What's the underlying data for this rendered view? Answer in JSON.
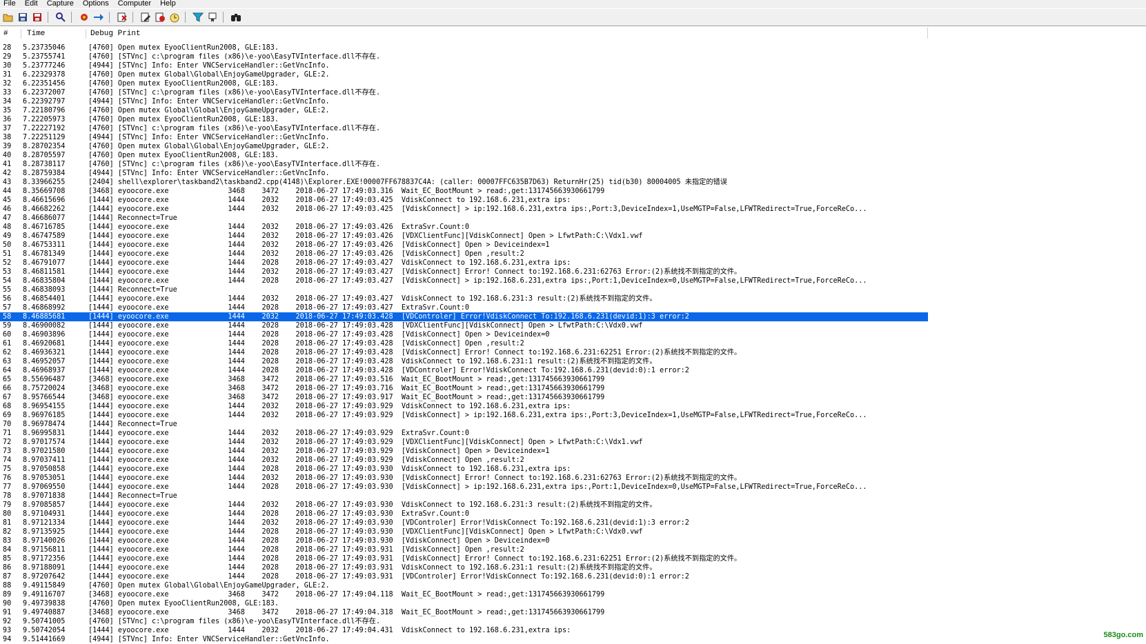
{
  "menu": [
    "File",
    "Edit",
    "Capture",
    "Options",
    "Computer",
    "Help"
  ],
  "toolbar_icons": [
    "open-icon",
    "save-icon",
    "save-as-icon",
    "find-icon",
    "capture-icon",
    "autoscroll-icon",
    "clear-icon",
    "edit-filter-icon",
    "highlight-icon",
    "history-icon",
    "filter-icon",
    "bookmark-icon",
    "binoculars-icon"
  ],
  "columns": [
    "#",
    "Time",
    "Debug Print"
  ],
  "selected_row": 58,
  "selection_color": "#0a67e8",
  "rows": [
    {
      "n": "28",
      "t": "5.23735046",
      "text": "[4760] Open mutex EyooClientRun2008, GLE:183."
    },
    {
      "n": "29",
      "t": "5.23755741",
      "text": "[4760] [STVnc] c:\\program files (x86)\\e-yoo\\EasyTVInterface.dll不存在."
    },
    {
      "n": "30",
      "t": "5.23777246",
      "text": "[4944] [STVnc] Info: Enter VNCServiceHandler::GetVncInfo."
    },
    {
      "n": "31",
      "t": "6.22329378",
      "text": "[4760] Open mutex Global\\Global\\EnjoyGameUpgrader, GLE:2."
    },
    {
      "n": "32",
      "t": "6.22351456",
      "text": "[4760] Open mutex EyooClientRun2008, GLE:183."
    },
    {
      "n": "33",
      "t": "6.22372007",
      "text": "[4760] [STVnc] c:\\program files (x86)\\e-yoo\\EasyTVInterface.dll不存在."
    },
    {
      "n": "34",
      "t": "6.22392797",
      "text": "[4944] [STVnc] Info: Enter VNCServiceHandler::GetVncInfo."
    },
    {
      "n": "35",
      "t": "7.22180796",
      "text": "[4760] Open mutex Global\\Global\\EnjoyGameUpgrader, GLE:2."
    },
    {
      "n": "36",
      "t": "7.22205973",
      "text": "[4760] Open mutex EyooClientRun2008, GLE:183."
    },
    {
      "n": "37",
      "t": "7.22227192",
      "text": "[4760] [STVnc] c:\\program files (x86)\\e-yoo\\EasyTVInterface.dll不存在."
    },
    {
      "n": "38",
      "t": "7.22251129",
      "text": "[4944] [STVnc] Info: Enter VNCServiceHandler::GetVncInfo."
    },
    {
      "n": "39",
      "t": "8.28702354",
      "text": "[4760] Open mutex Global\\Global\\EnjoyGameUpgrader, GLE:2."
    },
    {
      "n": "40",
      "t": "8.28705597",
      "text": "[4760] Open mutex EyooClientRun2008, GLE:183."
    },
    {
      "n": "41",
      "t": "8.28738117",
      "text": "[4760] [STVnc] c:\\program files (x86)\\e-yoo\\EasyTVInterface.dll不存在."
    },
    {
      "n": "42",
      "t": "8.28759384",
      "text": "[4944] [STVnc] Info: Enter VNCServiceHandler::GetVncInfo."
    },
    {
      "n": "43",
      "t": "8.33966255",
      "text": "[2404] shell\\explorer\\taskband2\\taskband2.cpp(4148)\\Explorer.EXE!00007FF678837C4A: (caller: 00007FFC635B7D63) ReturnHr(25) tid(b30) 80004005 未指定的错误"
    },
    {
      "n": "44",
      "t": "8.35669708",
      "text": "[3468] eyoocore.exe              3468    3472    2018-06-27 17:49:03.316  Wait_EC_BootMount > read:,get:131745663930661799"
    },
    {
      "n": "45",
      "t": "8.46615696",
      "text": "[1444] eyoocore.exe              1444    2032    2018-06-27 17:49:03.425  VdiskConnect to 192.168.6.231,extra ips:"
    },
    {
      "n": "46",
      "t": "8.46682262",
      "text": "[1444] eyoocore.exe              1444    2032    2018-06-27 17:49:03.425  [VdiskConnect] > ip:192.168.6.231,extra ips:,Port:3,DeviceIndex=1,UseMGTP=False,LFWTRedirect=True,ForceReCo..."
    },
    {
      "n": "47",
      "t": "8.46686077",
      "text": "[1444] Reconnect=True"
    },
    {
      "n": "48",
      "t": "8.46716785",
      "text": "[1444] eyoocore.exe              1444    2032    2018-06-27 17:49:03.426  ExtraSvr.Count:0"
    },
    {
      "n": "49",
      "t": "8.46747589",
      "text": "[1444] eyoocore.exe              1444    2032    2018-06-27 17:49:03.426  [VDXClientFunc][VdiskConnect] Open > LfwtPath:C:\\Vdx1.vwf"
    },
    {
      "n": "50",
      "t": "8.46753311",
      "text": "[1444] eyoocore.exe              1444    2032    2018-06-27 17:49:03.426  [VdiskConnect] Open > Deviceindex=1"
    },
    {
      "n": "51",
      "t": "8.46781349",
      "text": "[1444] eyoocore.exe              1444    2032    2018-06-27 17:49:03.426  [VdiskConnect] Open ,result:2"
    },
    {
      "n": "52",
      "t": "8.46791077",
      "text": "[1444] eyoocore.exe              1444    2028    2018-06-27 17:49:03.427  VdiskConnect to 192.168.6.231,extra ips:"
    },
    {
      "n": "53",
      "t": "8.46811581",
      "text": "[1444] eyoocore.exe              1444    2032    2018-06-27 17:49:03.427  [VdiskConnect] Error! Connect to:192.168.6.231:62763 Error:(2)系统找不到指定的文件。"
    },
    {
      "n": "54",
      "t": "8.46835804",
      "text": "[1444] eyoocore.exe              1444    2028    2018-06-27 17:49:03.427  [VdiskConnect] > ip:192.168.6.231,extra ips:,Port:1,DeviceIndex=0,UseMGTP=False,LFWTRedirect=True,ForceReCo..."
    },
    {
      "n": "55",
      "t": "8.46838093",
      "text": "[1444] Reconnect=True"
    },
    {
      "n": "56",
      "t": "8.46854401",
      "text": "[1444] eyoocore.exe              1444    2032    2018-06-27 17:49:03.427  VdiskConnect to 192.168.6.231:3 result:(2)系统找不到指定的文件。"
    },
    {
      "n": "57",
      "t": "8.46868992",
      "text": "[1444] eyoocore.exe              1444    2028    2018-06-27 17:49:03.427  ExtraSvr.Count:0"
    },
    {
      "n": "58",
      "t": "8.46885681",
      "text": "[1444] eyoocore.exe              1444    2032    2018-06-27 17:49:03.428  [VDControler] Error!VdiskConnect To:192.168.6.231(devid:1):3 error:2"
    },
    {
      "n": "59",
      "t": "8.46900082",
      "text": "[1444] eyoocore.exe              1444    2028    2018-06-27 17:49:03.428  [VDXClientFunc][VdiskConnect] Open > LfwtPath:C:\\Vdx0.vwf"
    },
    {
      "n": "60",
      "t": "8.46903896",
      "text": "[1444] eyoocore.exe              1444    2028    2018-06-27 17:49:03.428  [VdiskConnect] Open > Deviceindex=0"
    },
    {
      "n": "61",
      "t": "8.46920681",
      "text": "[1444] eyoocore.exe              1444    2028    2018-06-27 17:49:03.428  [VdiskConnect] Open ,result:2"
    },
    {
      "n": "62",
      "t": "8.46936321",
      "text": "[1444] eyoocore.exe              1444    2028    2018-06-27 17:49:03.428  [VdiskConnect] Error! Connect to:192.168.6.231:62251 Error:(2)系统找不到指定的文件。"
    },
    {
      "n": "63",
      "t": "8.46952057",
      "text": "[1444] eyoocore.exe              1444    2028    2018-06-27 17:49:03.428  VdiskConnect to 192.168.6.231:1 result:(2)系统找不到指定的文件。"
    },
    {
      "n": "64",
      "t": "8.46968937",
      "text": "[1444] eyoocore.exe              1444    2028    2018-06-27 17:49:03.428  [VDControler] Error!VdiskConnect To:192.168.6.231(devid:0):1 error:2"
    },
    {
      "n": "65",
      "t": "8.55696487",
      "text": "[3468] eyoocore.exe              3468    3472    2018-06-27 17:49:03.516  Wait_EC_BootMount > read:,get:131745663930661799"
    },
    {
      "n": "66",
      "t": "8.75720024",
      "text": "[3468] eyoocore.exe              3468    3472    2018-06-27 17:49:03.716  Wait_EC_BootMount > read:,get:131745663930661799"
    },
    {
      "n": "67",
      "t": "8.95766544",
      "text": "[3468] eyoocore.exe              3468    3472    2018-06-27 17:49:03.917  Wait_EC_BootMount > read:,get:131745663930661799"
    },
    {
      "n": "68",
      "t": "8.96954155",
      "text": "[1444] eyoocore.exe              1444    2032    2018-06-27 17:49:03.929  VdiskConnect to 192.168.6.231,extra ips:"
    },
    {
      "n": "69",
      "t": "8.96976185",
      "text": "[1444] eyoocore.exe              1444    2032    2018-06-27 17:49:03.929  [VdiskConnect] > ip:192.168.6.231,extra ips:,Port:3,DeviceIndex=1,UseMGTP=False,LFWTRedirect=True,ForceReCo..."
    },
    {
      "n": "70",
      "t": "8.96978474",
      "text": "[1444] Reconnect=True"
    },
    {
      "n": "71",
      "t": "8.96995831",
      "text": "[1444] eyoocore.exe              1444    2032    2018-06-27 17:49:03.929  ExtraSvr.Count:0"
    },
    {
      "n": "72",
      "t": "8.97017574",
      "text": "[1444] eyoocore.exe              1444    2032    2018-06-27 17:49:03.929  [VDXClientFunc][VdiskConnect] Open > LfwtPath:C:\\Vdx1.vwf"
    },
    {
      "n": "73",
      "t": "8.97021580",
      "text": "[1444] eyoocore.exe              1444    2032    2018-06-27 17:49:03.929  [VdiskConnect] Open > Deviceindex=1"
    },
    {
      "n": "74",
      "t": "8.97037411",
      "text": "[1444] eyoocore.exe              1444    2032    2018-06-27 17:49:03.929  [VdiskConnect] Open ,result:2"
    },
    {
      "n": "75",
      "t": "8.97050858",
      "text": "[1444] eyoocore.exe              1444    2028    2018-06-27 17:49:03.930  VdiskConnect to 192.168.6.231,extra ips:"
    },
    {
      "n": "76",
      "t": "8.97053051",
      "text": "[1444] eyoocore.exe              1444    2032    2018-06-27 17:49:03.930  [VdiskConnect] Error! Connect to:192.168.6.231:62763 Error:(2)系统找不到指定的文件。"
    },
    {
      "n": "77",
      "t": "8.97069550",
      "text": "[1444] eyoocore.exe              1444    2028    2018-06-27 17:49:03.930  [VdiskConnect] > ip:192.168.6.231,extra ips:,Port:1,DeviceIndex=0,UseMGTP=False,LFWTRedirect=True,ForceReCo..."
    },
    {
      "n": "78",
      "t": "8.97071838",
      "text": "[1444] Reconnect=True"
    },
    {
      "n": "79",
      "t": "8.97085857",
      "text": "[1444] eyoocore.exe              1444    2032    2018-06-27 17:49:03.930  VdiskConnect to 192.168.6.231:3 result:(2)系统找不到指定的文件。"
    },
    {
      "n": "80",
      "t": "8.97104931",
      "text": "[1444] eyoocore.exe              1444    2028    2018-06-27 17:49:03.930  ExtraSvr.Count:0"
    },
    {
      "n": "81",
      "t": "8.97121334",
      "text": "[1444] eyoocore.exe              1444    2032    2018-06-27 17:49:03.930  [VDControler] Error!VdiskConnect To:192.168.6.231(devid:1):3 error:2"
    },
    {
      "n": "82",
      "t": "8.97135925",
      "text": "[1444] eyoocore.exe              1444    2028    2018-06-27 17:49:03.930  [VDXClientFunc][VdiskConnect] Open > LfwtPath:C:\\Vdx0.vwf"
    },
    {
      "n": "83",
      "t": "8.97140026",
      "text": "[1444] eyoocore.exe              1444    2028    2018-06-27 17:49:03.930  [VdiskConnect] Open > Deviceindex=0"
    },
    {
      "n": "84",
      "t": "8.97156811",
      "text": "[1444] eyoocore.exe              1444    2028    2018-06-27 17:49:03.931  [VdiskConnect] Open ,result:2"
    },
    {
      "n": "85",
      "t": "8.97172356",
      "text": "[1444] eyoocore.exe              1444    2028    2018-06-27 17:49:03.931  [VdiskConnect] Error! Connect to:192.168.6.231:62251 Error:(2)系统找不到指定的文件。"
    },
    {
      "n": "86",
      "t": "8.97188091",
      "text": "[1444] eyoocore.exe              1444    2028    2018-06-27 17:49:03.931  VdiskConnect to 192.168.6.231:1 result:(2)系统找不到指定的文件。"
    },
    {
      "n": "87",
      "t": "8.97207642",
      "text": "[1444] eyoocore.exe              1444    2028    2018-06-27 17:49:03.931  [VDControler] Error!VdiskConnect To:192.168.6.231(devid:0):1 error:2"
    },
    {
      "n": "88",
      "t": "9.49115849",
      "text": "[4760] Open mutex Global\\Global\\EnjoyGameUpgrader, GLE:2."
    },
    {
      "n": "89",
      "t": "9.49116707",
      "text": "[3468] eyoocore.exe              3468    3472    2018-06-27 17:49:04.118  Wait_EC_BootMount > read:,get:131745663930661799"
    },
    {
      "n": "90",
      "t": "9.49739838",
      "text": "[4760] Open mutex EyooClientRun2008, GLE:183."
    },
    {
      "n": "91",
      "t": "9.49740887",
      "text": "[3468] eyoocore.exe              3468    3472    2018-06-27 17:49:04.318  Wait_EC_BootMount > read:,get:131745663930661799"
    },
    {
      "n": "92",
      "t": "9.50741005",
      "text": "[4760] [STVnc] c:\\program files (x86)\\e-yoo\\EasyTVInterface.dll不存在."
    },
    {
      "n": "93",
      "t": "9.50742054",
      "text": "[1444] eyoocore.exe              1444    2032    2018-06-27 17:49:04.431  VdiskConnect to 192.168.6.231,extra ips:"
    },
    {
      "n": "94",
      "t": "9.51441669",
      "text": "[4944] [STVnc] Info: Enter VNCServiceHandler::GetVncInfo."
    }
  ],
  "watermark": "583go.com"
}
